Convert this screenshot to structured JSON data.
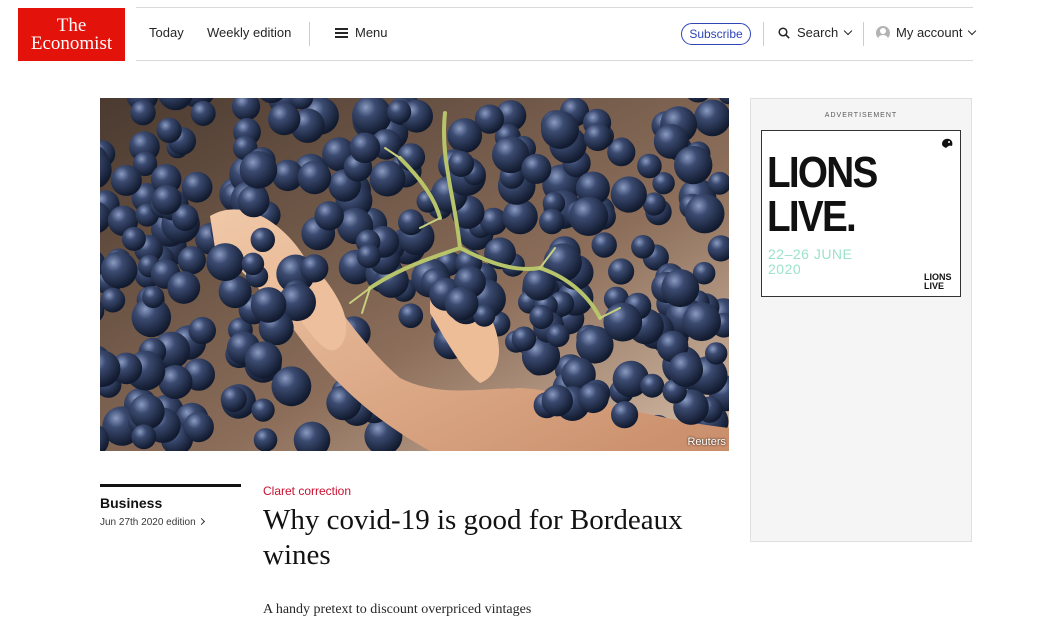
{
  "brand": {
    "line1": "The",
    "line2": "Economist",
    "color": "#e3120b"
  },
  "nav": {
    "today": "Today",
    "weekly_edition": "Weekly edition",
    "menu": "Menu",
    "subscribe": "Subscribe",
    "search": "Search",
    "my_account": "My account"
  },
  "hero": {
    "credit": "Reuters"
  },
  "ad": {
    "label": "ADVERTISEMENT",
    "title_line1": "LIONS",
    "title_line2": "LIVE.",
    "date_line1": "22–26 JUNE",
    "date_line2": "2020",
    "mini_line1": "LIONS",
    "mini_line2": "LIVE",
    "accent": "#9be3c9"
  },
  "article": {
    "section": "Business",
    "edition": "Jun 27th 2020 edition",
    "rubric": "Claret correction",
    "headline": "Why covid-19 is good for Bordeaux wines",
    "standfirst": "A handy pretext to discount overpriced vintages",
    "rubric_color": "#c8102e"
  }
}
